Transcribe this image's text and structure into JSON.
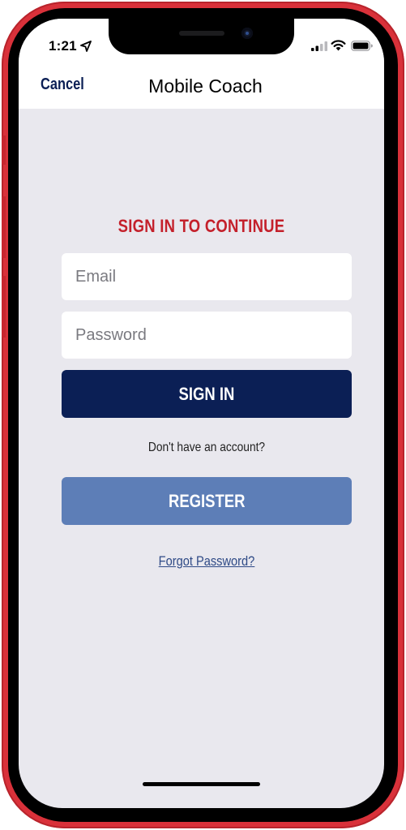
{
  "status_bar": {
    "time": "1:21",
    "icons": [
      "location-arrow-icon",
      "cellular-signal-icon",
      "wifi-icon",
      "battery-icon"
    ]
  },
  "nav": {
    "cancel_label": "Cancel",
    "title": "Mobile Coach"
  },
  "login": {
    "heading": "SIGN IN TO CONTINUE",
    "email_placeholder": "Email",
    "password_placeholder": "Password",
    "signin_label": "SIGN IN",
    "no_account_text": "Don't have an account?",
    "register_label": "REGISTER",
    "forgot_label": "Forgot Password?"
  },
  "colors": {
    "device_frame": "#d9313a",
    "heading_red": "#c4202b",
    "navy": "#0b1f55",
    "register_blue": "#5d7eb7",
    "background": "#e9e8ee"
  }
}
